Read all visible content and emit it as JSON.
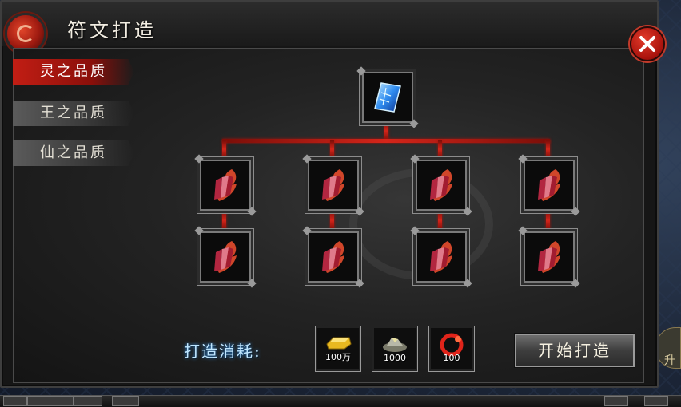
{
  "window": {
    "title": "符文打造"
  },
  "tabs": [
    {
      "label": "灵之品质",
      "active": true
    },
    {
      "label": "王之品质",
      "active": false
    },
    {
      "label": "仙之品质",
      "active": false
    }
  ],
  "tree": {
    "result": {
      "icon": "blue-rune-card-icon"
    },
    "materials": [
      {
        "icon": "red-crystal-shard-icon"
      },
      {
        "icon": "red-crystal-shard-icon"
      },
      {
        "icon": "red-crystal-shard-icon"
      },
      {
        "icon": "red-crystal-shard-icon"
      },
      {
        "icon": "red-crystal-shard-icon"
      },
      {
        "icon": "red-crystal-shard-icon"
      },
      {
        "icon": "red-crystal-shard-icon"
      },
      {
        "icon": "red-crystal-shard-icon"
      }
    ]
  },
  "cost": {
    "label": "打造消耗:",
    "items": [
      {
        "icon": "gold-ingot-icon",
        "amount": "100万"
      },
      {
        "icon": "ore-pile-icon",
        "amount": "1000"
      },
      {
        "icon": "red-spirit-orb-icon",
        "amount": "100"
      }
    ]
  },
  "actions": {
    "start_label": "开始打造"
  },
  "side_widget": {
    "label": "升"
  },
  "colors": {
    "accent": "#c21e14",
    "cost_label": "#bfe6ff",
    "connector": "#d4251a"
  }
}
